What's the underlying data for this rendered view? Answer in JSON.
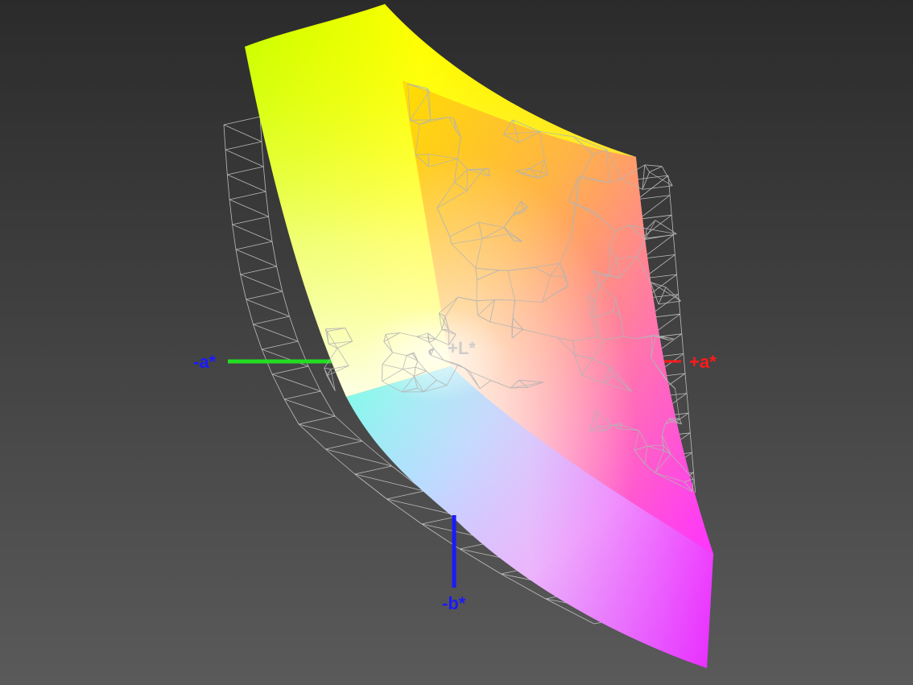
{
  "chart_data": {
    "type": "3d-gamut",
    "axes": [
      {
        "label": "-a*",
        "color": "#1a1aff",
        "line_color": "#22dd22"
      },
      {
        "label": "+a*",
        "color": "#ff1a1a",
        "line_color": "#ff1a1a"
      },
      {
        "label": "-b*",
        "color": "#1a1aff",
        "line_color": "#1a1aff"
      },
      {
        "label": "+L*",
        "color": "#c8c8c8",
        "line_color": "#c8c8c8"
      }
    ],
    "surface_colors": {
      "yellow": "#ffff00",
      "green_yellow": "#c8ff00",
      "orange": "#ff7a00",
      "magenta": "#ff33ff",
      "violet": "#b41eff",
      "cyan": "#80ffe6",
      "white": "#fffff0"
    },
    "wireframe_color": "#d2d2d2",
    "background_colors": {
      "top": "#2b2b2b",
      "bottom": "#5a5a5a"
    }
  }
}
